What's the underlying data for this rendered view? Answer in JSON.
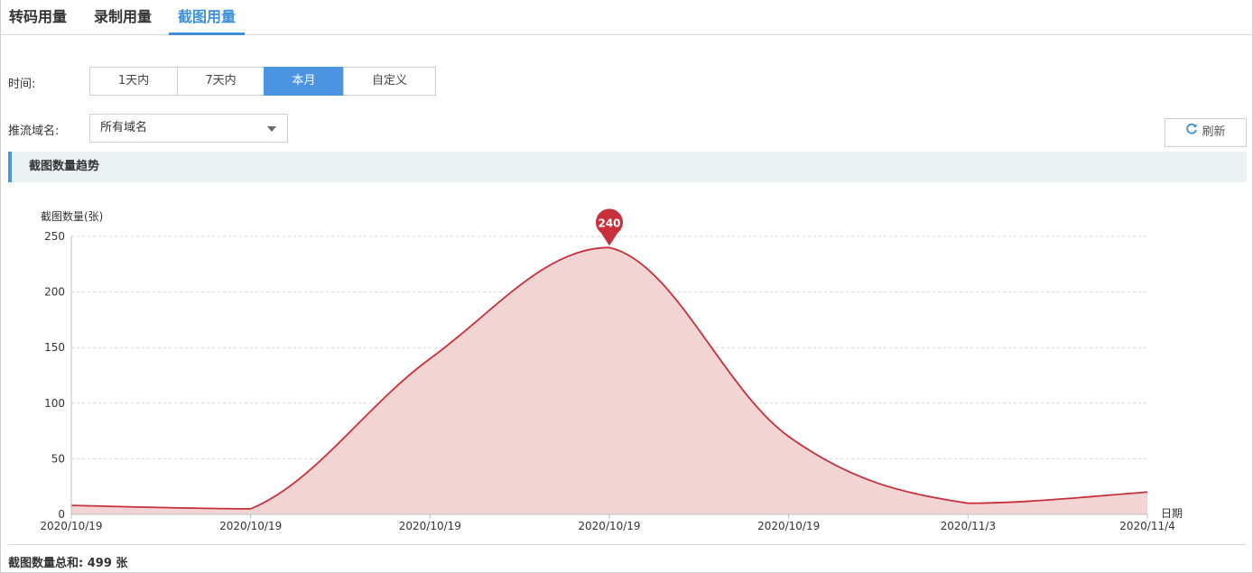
{
  "tabs": [
    {
      "label": "转码用量"
    },
    {
      "label": "录制用量"
    },
    {
      "label": "截图用量",
      "active": true
    }
  ],
  "filters": {
    "time_label": "时间:",
    "time_options": [
      "1天内",
      "7天内",
      "本月",
      "自定义"
    ],
    "time_selected": "本月",
    "domain_label": "推流域名:",
    "domain_value": "所有域名"
  },
  "refresh_label": "刷新",
  "section_title": "截图数量趋势",
  "chart_data": {
    "type": "area",
    "ylabel": "截图数量(张)",
    "xlabel": "日期",
    "x": [
      "2020/10/19",
      "2020/10/19",
      "2020/10/19",
      "2020/10/19",
      "2020/10/19",
      "2020/11/3",
      "2020/11/4"
    ],
    "series": [
      {
        "values": [
          8,
          5,
          140,
          240,
          70,
          10,
          20
        ]
      }
    ],
    "ylim": [
      0,
      250
    ],
    "yticks": [
      0,
      50,
      100,
      150,
      200,
      250
    ],
    "max_marker": {
      "value": 240,
      "label": "240"
    },
    "grid": true,
    "colors": {
      "line": "#c7303a",
      "fill": "#f2d4d5"
    }
  },
  "summary": "截图数量总和: 499 张"
}
